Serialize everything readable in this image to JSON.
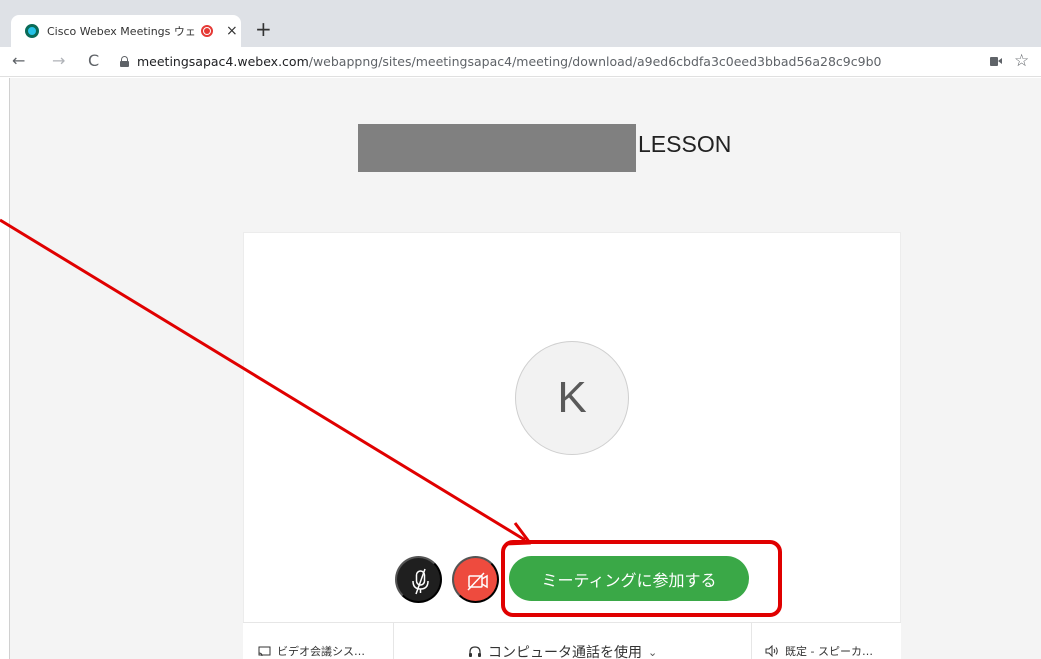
{
  "browser": {
    "tab_title": "Cisco Webex Meetings ウェブ",
    "tab_close": "×",
    "new_tab": "+",
    "url_host": "meetingsapac4.webex.com",
    "url_path": "/webappng/sites/meetingsapac4/meeting/download/a9ed6cbdfa3c0eed3bbad56a28c9c9b0",
    "nav_back": "←",
    "nav_forward": "→",
    "nav_reload": "C",
    "star": "☆"
  },
  "meeting": {
    "title": "LESSON",
    "avatar_initial": "K",
    "join_label": "ミーティングに参加する"
  },
  "bottom_bar": {
    "video_system": "ビデオ会議シス…",
    "audio": "コンピュータ通話を使用",
    "speaker": "既定 - スピーカ…"
  },
  "icons": {
    "favicon": "webex-favicon-icon",
    "recording": "recording-icon",
    "lock": "lock-icon",
    "camera": "camera-icon",
    "mute": "microphone-muted-icon",
    "video": "video-off-icon",
    "cast": "cast-icon",
    "headset": "headset-icon",
    "speaker": "speaker-icon"
  },
  "colors": {
    "join_green": "#3aa847",
    "video_red": "#ee4b3e",
    "annotation_red": "#e00000"
  }
}
